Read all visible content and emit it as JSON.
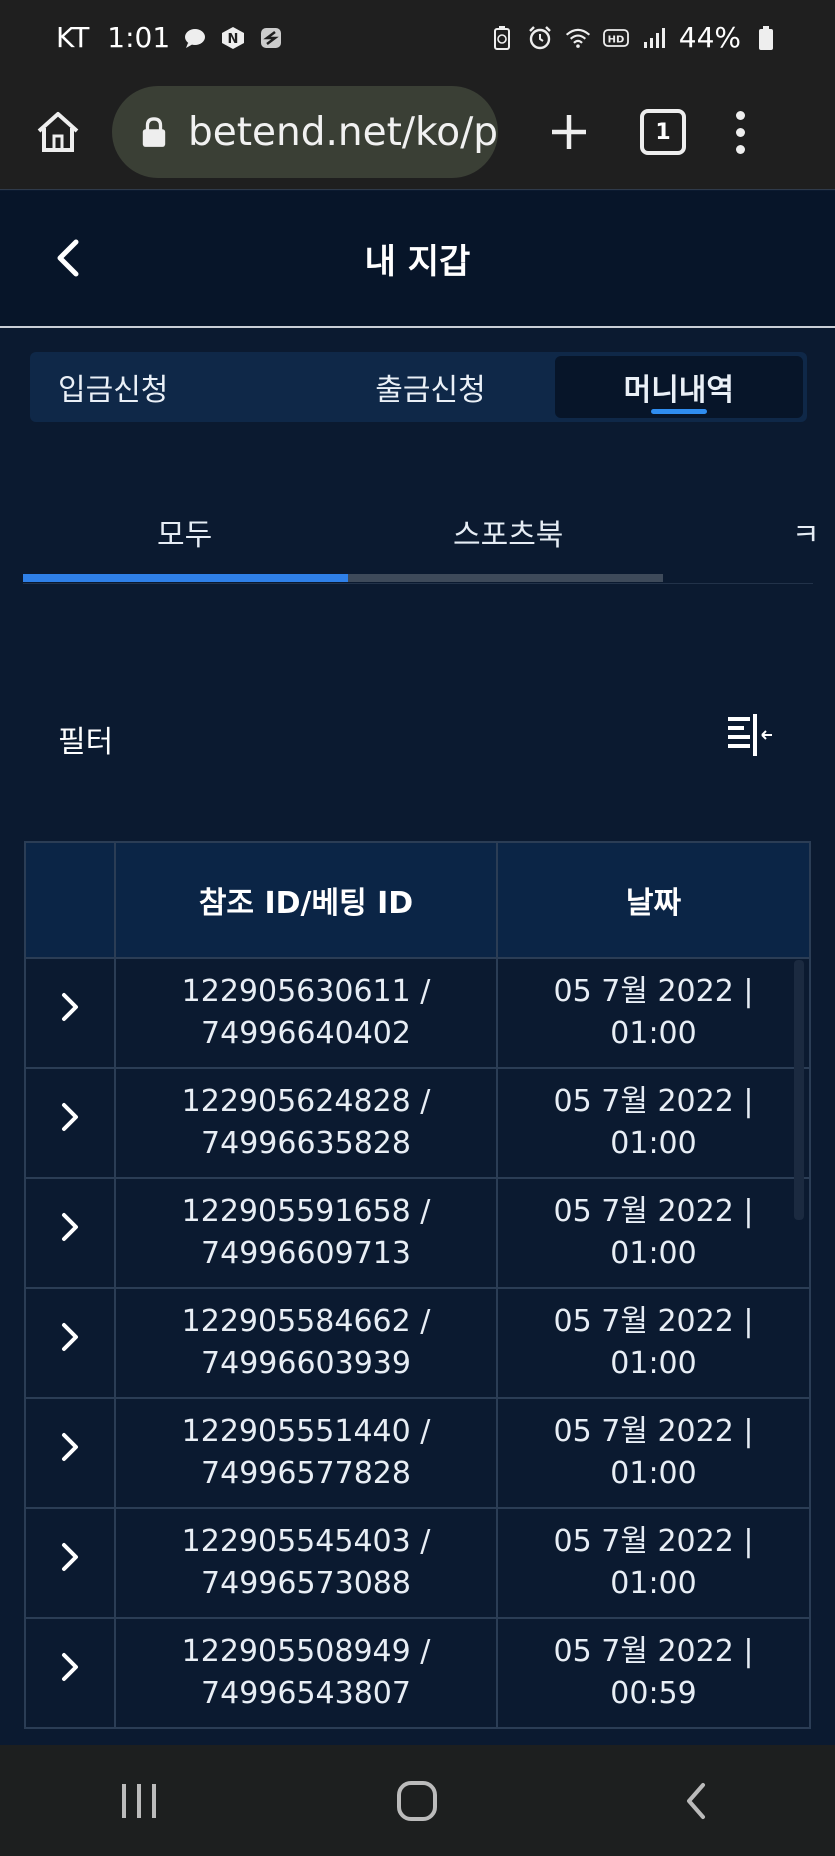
{
  "status_bar": {
    "carrier": "KT",
    "time": "1:01",
    "battery": "44%",
    "icons_left": [
      "chat-bubble-icon",
      "n-notification-icon",
      "s-app-icon"
    ],
    "icons_right": [
      "battery-saver-icon",
      "alarm-icon",
      "wifi-icon",
      "hd-icon",
      "signal-icon",
      "battery-icon"
    ]
  },
  "browser": {
    "url": "betend.net/ko/p",
    "tab_count": "1"
  },
  "header": {
    "title": "내 지갑"
  },
  "segment_tabs": [
    {
      "label": "입금신청",
      "active": false
    },
    {
      "label": "출금신청",
      "active": false
    },
    {
      "label": "머니내역",
      "active": true
    }
  ],
  "sub_tabs": [
    {
      "label": "모두",
      "active": true
    },
    {
      "label": "스포츠북",
      "active": false
    },
    {
      "label": "ㅋ",
      "active": false
    }
  ],
  "filter": {
    "label": "필터"
  },
  "table": {
    "headers": [
      "",
      "참조 ID/베팅 ID",
      "날짜"
    ],
    "rows": [
      {
        "ref": "122905630611 /",
        "bet": "74996640402",
        "date": "05 7월 2022 |",
        "time": "01:00"
      },
      {
        "ref": "122905624828 /",
        "bet": "74996635828",
        "date": "05 7월 2022 |",
        "time": "01:00"
      },
      {
        "ref": "122905591658 /",
        "bet": "74996609713",
        "date": "05 7월 2022 |",
        "time": "01:00"
      },
      {
        "ref": "122905584662 /",
        "bet": "74996603939",
        "date": "05 7월 2022 |",
        "time": "01:00"
      },
      {
        "ref": "122905551440 /",
        "bet": "74996577828",
        "date": "05 7월 2022 |",
        "time": "01:00"
      },
      {
        "ref": "122905545403 /",
        "bet": "74996573088",
        "date": "05 7월 2022 |",
        "time": "01:00"
      },
      {
        "ref": "122905508949 /",
        "bet": "74996543807",
        "date": "05 7월 2022 |",
        "time": "00:59"
      }
    ]
  },
  "colors": {
    "page_bg": "#0b1a30",
    "header_bg": "#071529",
    "accent": "#2f80e8",
    "table_header_bg": "#0b2546"
  }
}
